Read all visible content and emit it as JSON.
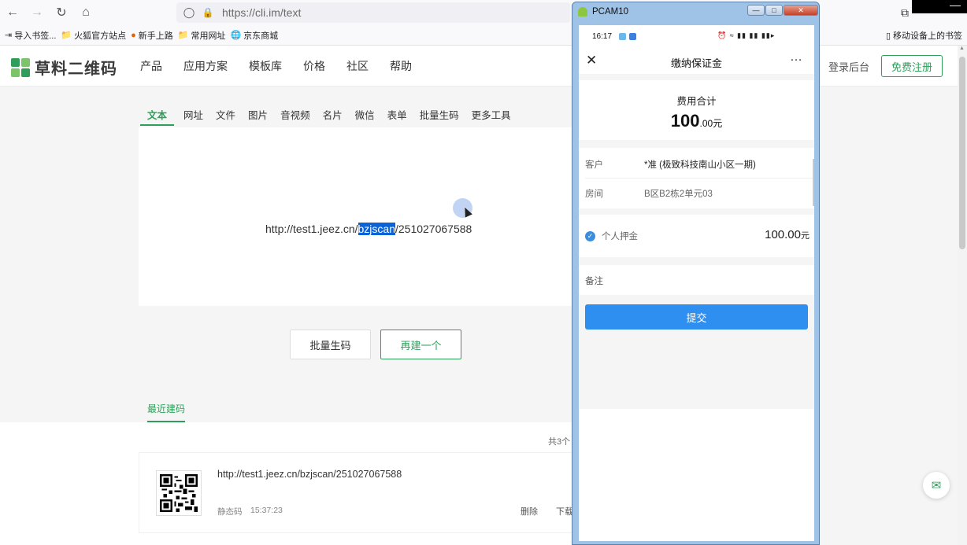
{
  "browser": {
    "url": "https://cli.im/text",
    "bookmarks": [
      "导入书签...",
      "火狐官方站点",
      "新手上路",
      "常用网址",
      "京东商城"
    ],
    "mobile_bookmarks": "移动设备上的书签"
  },
  "site": {
    "logo_text": "草料二维码",
    "nav": [
      "产品",
      "应用方案",
      "模板库",
      "价格",
      "社区",
      "帮助"
    ],
    "login": "登录后台",
    "register": "免费注册"
  },
  "tabs": [
    "文本",
    "网址",
    "文件",
    "图片",
    "音视频",
    "名片",
    "微信",
    "表单",
    "批量生码",
    "更多工具"
  ],
  "editor": {
    "text_before": "http://test1.jeez.cn/",
    "text_selected": "bzjscan",
    "text_after": "/251027067588"
  },
  "actions": {
    "batch": "批量生码",
    "new": "再建一个"
  },
  "recent": {
    "tab": "最近建码",
    "total": "共3个",
    "record_url": "http://test1.jeez.cn/bzjscan/251027067588",
    "record_type": "静态码",
    "record_time": "15:37:23",
    "delete": "删除",
    "download": "下载"
  },
  "emulator": {
    "title": "PCAM10",
    "status_time": "16:17",
    "app_title": "缴纳保证金",
    "fee_label": "费用合计",
    "fee_int": "100",
    "fee_dec": ".00",
    "fee_unit": "元",
    "customer_label": "客户",
    "customer_value": "*准 (极致科技南山小区一期)",
    "room_label": "房间",
    "room_value": "B区B2栋2单元03",
    "deposit_label": "个人押金",
    "deposit_value": "100.00",
    "deposit_unit": "元",
    "remark_label": "备注",
    "submit": "提交"
  },
  "colors": {
    "brand_green": "#2f9e5b",
    "selection_blue": "#0a64d8",
    "submit_blue": "#2f8ff0"
  }
}
